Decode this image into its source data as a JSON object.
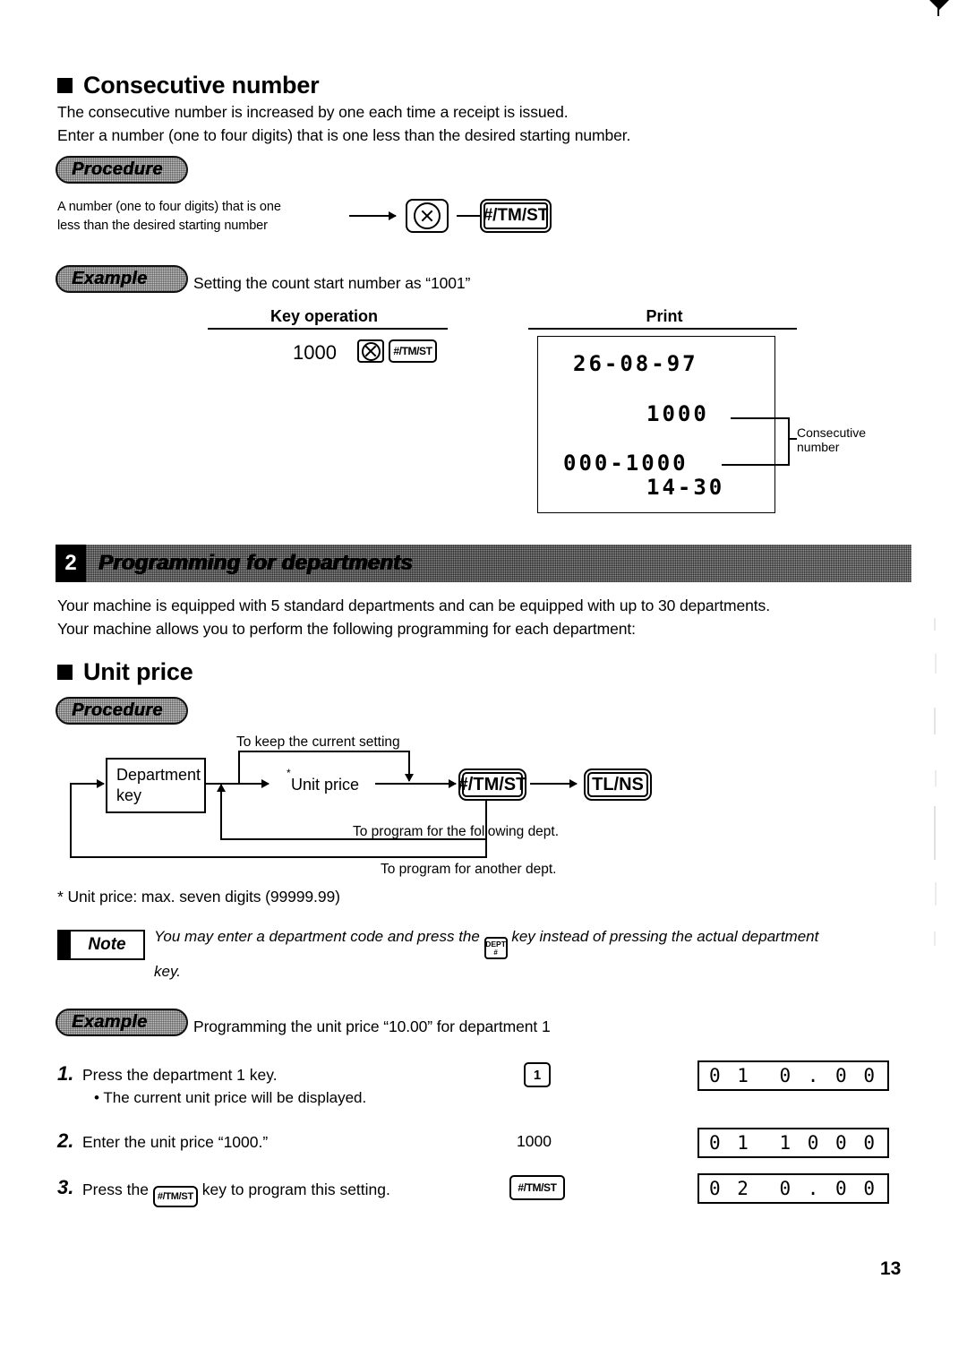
{
  "page": {
    "number": "13"
  },
  "section_consecutive": {
    "heading": "Consecutive number",
    "intro_line1": "The consecutive number is increased by one each time a receipt is issued.",
    "intro_line2": "Enter a number (one to four digits) that is one less than the desired starting number.",
    "procedure_label": "Procedure",
    "procedure": {
      "input_line1": "A number (one to four digits) that is one",
      "input_line2": "less than the desired starting number",
      "key_multiply": "⊗",
      "key_tmst": "#/TM/ST"
    },
    "example_label": "Example",
    "example_caption": "Setting the count start number as “1001”",
    "columns": {
      "key_operation": "Key operation",
      "print": "Print"
    },
    "key_operation_entry": "1000",
    "key_operation_keys": [
      "⊗",
      "#/TM/ST"
    ],
    "print_receipt": {
      "line1": "26-08-97",
      "line2": "1000",
      "line3": "000-1000",
      "line4": "14-30"
    },
    "callout": {
      "line1": "Consecutive",
      "line2": "number"
    }
  },
  "section_departments": {
    "banner_number": "2",
    "banner_title": "Programming for departments",
    "intro_line1": "Your machine is equipped with 5 standard departments and can be equipped with up to 30 departments.",
    "intro_line2": "Your machine allows you to perform the following programming for each department:"
  },
  "section_unit_price": {
    "heading": "Unit price",
    "procedure_label": "Procedure",
    "flow": {
      "top_label": "To keep the current setting",
      "dept_box_line1": "Department",
      "dept_box_line2": "key",
      "unit_price_label": "Unit price",
      "unit_price_asterisk": "*",
      "key_tmst": "#/TM/ST",
      "key_tlns": "TL/NS",
      "loop_label_1": "To program for the following dept.",
      "loop_label_2": "To program for another dept."
    },
    "footnote": "* Unit price: max. seven digits (99999.99)",
    "note": {
      "label": "Note",
      "text_part1": "You may enter a department code and press the",
      "dept_key_top": "DEPT",
      "dept_key_bottom": "#",
      "text_part2": "key instead of pressing the actual department",
      "text_part3": "key."
    },
    "example_label": "Example",
    "example_caption": "Programming the unit price “10.00” for department 1",
    "steps": [
      {
        "number": "1.",
        "text": "Press the department 1 key.",
        "subtext": "• The current unit price will be displayed.",
        "operation_key": "1",
        "operation_is_key": true,
        "display_left": "0 1",
        "display_right": "0 . 0 0"
      },
      {
        "number": "2.",
        "text": "Enter the unit price “1000.”",
        "subtext": "",
        "operation_key": "1000",
        "operation_is_key": false,
        "display_left": "0 1",
        "display_right": "1 0 0 0"
      },
      {
        "number": "3.",
        "text_before": "Press the",
        "text_key": "#/TM/ST",
        "text_after": "key to program this setting.",
        "subtext": "",
        "operation_key": "#/TM/ST",
        "operation_is_key": true,
        "display_left": "0 2",
        "display_right": "0 . 0 0"
      }
    ]
  }
}
